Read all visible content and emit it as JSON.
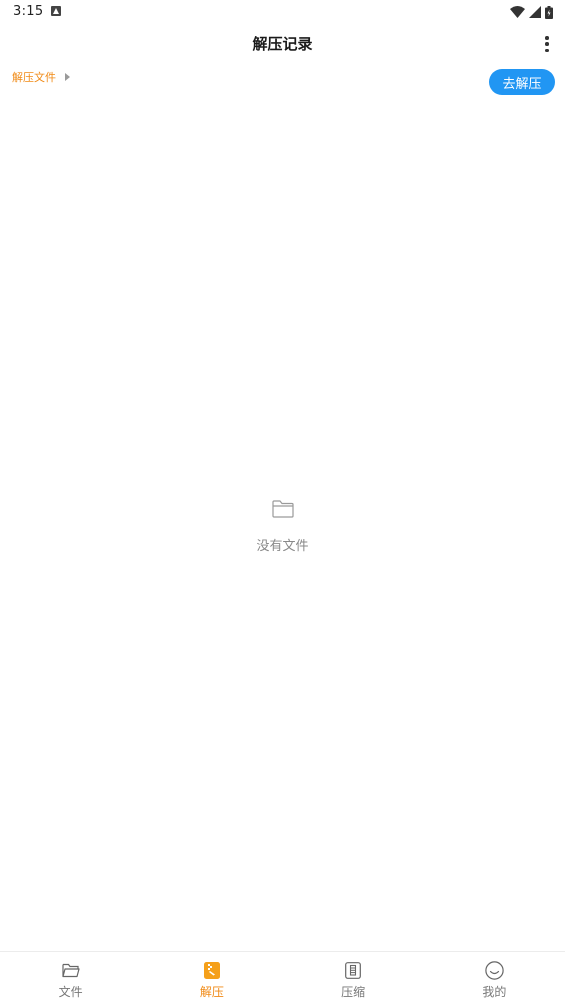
{
  "status_bar": {
    "time": "3:15"
  },
  "header": {
    "title": "解压记录"
  },
  "breadcrumb": {
    "items": [
      "解压文件"
    ]
  },
  "actions": {
    "extract_label": "去解压"
  },
  "empty_state": {
    "message": "没有文件"
  },
  "bottom_nav": {
    "items": [
      {
        "label": "文件",
        "icon": "folder-open-icon",
        "active": false
      },
      {
        "label": "解压",
        "icon": "extract-icon",
        "active": true
      },
      {
        "label": "压缩",
        "icon": "archive-icon",
        "active": false
      },
      {
        "label": "我的",
        "icon": "smiley-icon",
        "active": false
      }
    ]
  },
  "colors": {
    "accent": "#f08a16",
    "primary_button": "#2196f3",
    "inactive": "#777777"
  }
}
